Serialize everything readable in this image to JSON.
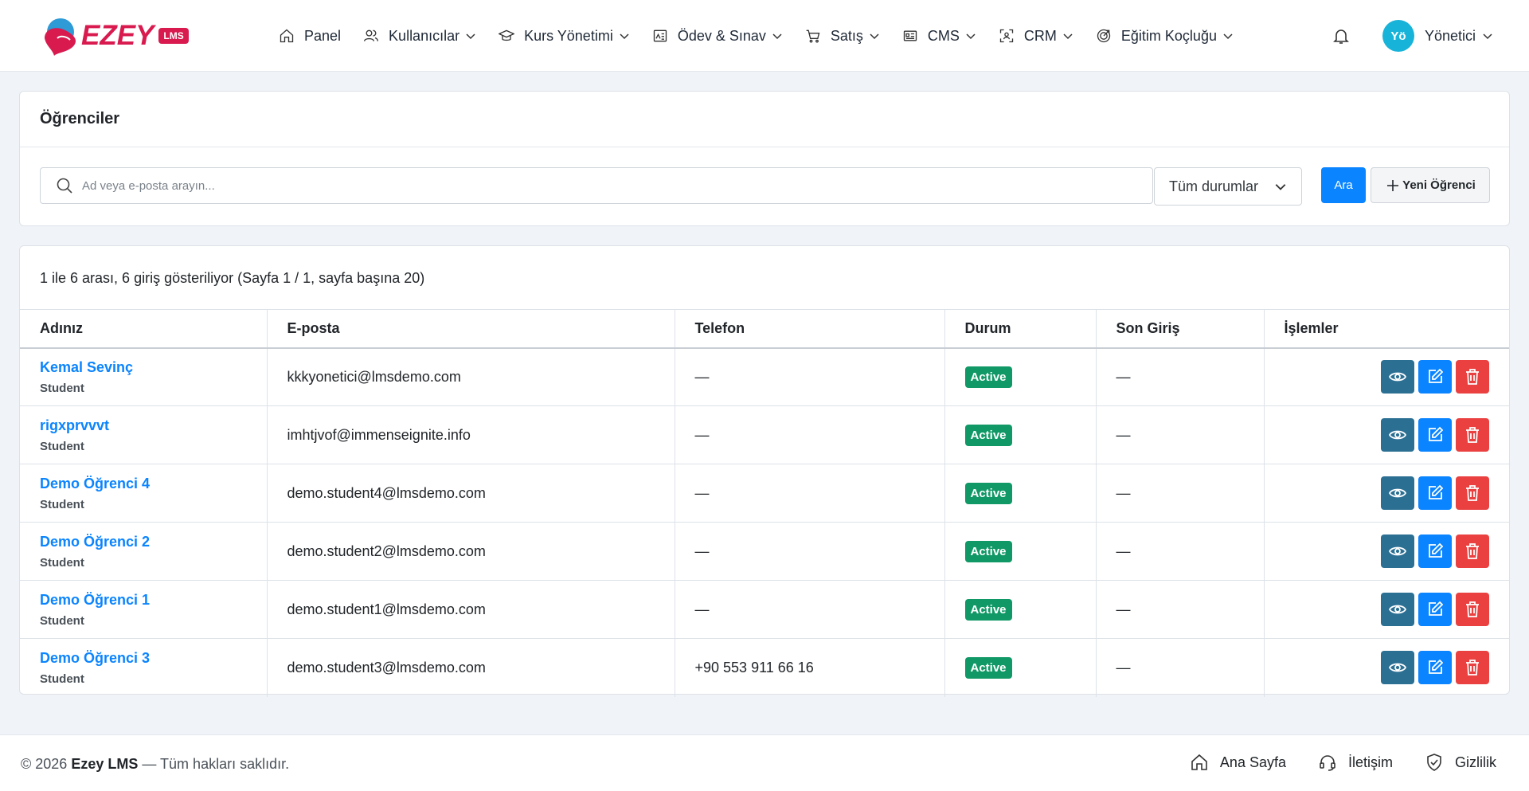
{
  "brand": {
    "name": "EZEY",
    "badge": "LMS",
    "primary_color": "#d81a4f"
  },
  "nav": {
    "items": [
      {
        "label": "Panel",
        "icon": "home-icon",
        "has_dropdown": false
      },
      {
        "label": "Kullanıcılar",
        "icon": "users-icon",
        "has_dropdown": true
      },
      {
        "label": "Kurs Yönetimi",
        "icon": "graduation-cap-icon",
        "has_dropdown": true
      },
      {
        "label": "Ödev & Sınav",
        "icon": "assignment-icon",
        "has_dropdown": true
      },
      {
        "label": "Satış",
        "icon": "cart-icon",
        "has_dropdown": true
      },
      {
        "label": "CMS",
        "icon": "newspaper-icon",
        "has_dropdown": true
      },
      {
        "label": "CRM",
        "icon": "scan-user-icon",
        "has_dropdown": true
      },
      {
        "label": "Eğitim Koçluğu",
        "icon": "target-icon",
        "has_dropdown": true
      }
    ],
    "notifications_icon": "bell-icon",
    "user": {
      "initials": "Yö",
      "name": "Yönetici",
      "avatar_color": "#17b3d9"
    }
  },
  "filters": {
    "title": "Öğrenciler",
    "search_placeholder": "Ad veya e-posta arayın...",
    "search_value": "",
    "status_selected": "Tüm durumlar",
    "search_button": "Ara",
    "new_button": "Yeni Öğrenci"
  },
  "list": {
    "summary": "1 ile 6 arası, 6 giriş gösteriliyor (Sayfa 1 / 1, sayfa başına 20)",
    "columns": [
      "Adınız",
      "E-posta",
      "Telefon",
      "Durum",
      "Son Giriş",
      "İşlemler"
    ],
    "rows": [
      {
        "name": "Kemal Sevinç",
        "role": "Student",
        "email": "kkkyonetici@lmsdemo.com",
        "phone": "—",
        "status": "Active",
        "last_login": "—"
      },
      {
        "name": "rigxprvvvt",
        "role": "Student",
        "email": "imhtjvof@immenseignite.info",
        "phone": "—",
        "status": "Active",
        "last_login": "—"
      },
      {
        "name": "Demo Öğrenci 4",
        "role": "Student",
        "email": "demo.student4@lmsdemo.com",
        "phone": "—",
        "status": "Active",
        "last_login": "—"
      },
      {
        "name": "Demo Öğrenci 2",
        "role": "Student",
        "email": "demo.student2@lmsdemo.com",
        "phone": "—",
        "status": "Active",
        "last_login": "—"
      },
      {
        "name": "Demo Öğrenci 1",
        "role": "Student",
        "email": "demo.student1@lmsdemo.com",
        "phone": "—",
        "status": "Active",
        "last_login": "—"
      },
      {
        "name": "Demo Öğrenci 3",
        "role": "Student",
        "email": "demo.student3@lmsdemo.com",
        "phone": "+90 553 911 66 16",
        "status": "Active",
        "last_login": "—"
      }
    ],
    "status_color": "#109866",
    "action_colors": {
      "view": "#2b6f93",
      "edit": "#0a84ff",
      "delete": "#ea4040"
    }
  },
  "footer": {
    "copyright_prefix": "© 2026",
    "brand": "Ezey LMS",
    "copyright_suffix": "— Tüm hakları saklıdır.",
    "links": [
      {
        "label": "Ana Sayfa",
        "icon": "home-icon"
      },
      {
        "label": "İletişim",
        "icon": "headset-icon"
      },
      {
        "label": "Gizlilik",
        "icon": "shield-check-icon"
      }
    ]
  }
}
